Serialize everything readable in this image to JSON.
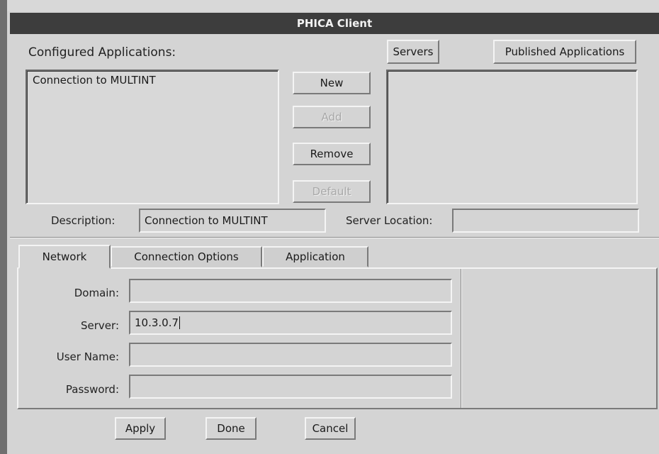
{
  "window": {
    "title": "PHICA Client"
  },
  "configured": {
    "heading": "Configured Applications:",
    "items": [
      "Connection to MULTINT"
    ]
  },
  "actions": {
    "new": "New",
    "add": "Add",
    "remove": "Remove",
    "default": "Default"
  },
  "right": {
    "servers": "Servers",
    "published": "Published Applications"
  },
  "description": {
    "label": "Description:",
    "value": "Connection to MULTINT"
  },
  "server_location": {
    "label": "Server Location:",
    "value": ""
  },
  "tabs": [
    "Network",
    "Connection Options",
    "Application"
  ],
  "network": {
    "domain_label": "Domain:",
    "domain_value": "",
    "server_label": "Server:",
    "server_value": "10.3.0.7",
    "username_label": "User Name:",
    "username_value": "",
    "password_label": "Password:",
    "password_value": ""
  },
  "footer": {
    "apply": "Apply",
    "done": "Done",
    "cancel": "Cancel"
  }
}
